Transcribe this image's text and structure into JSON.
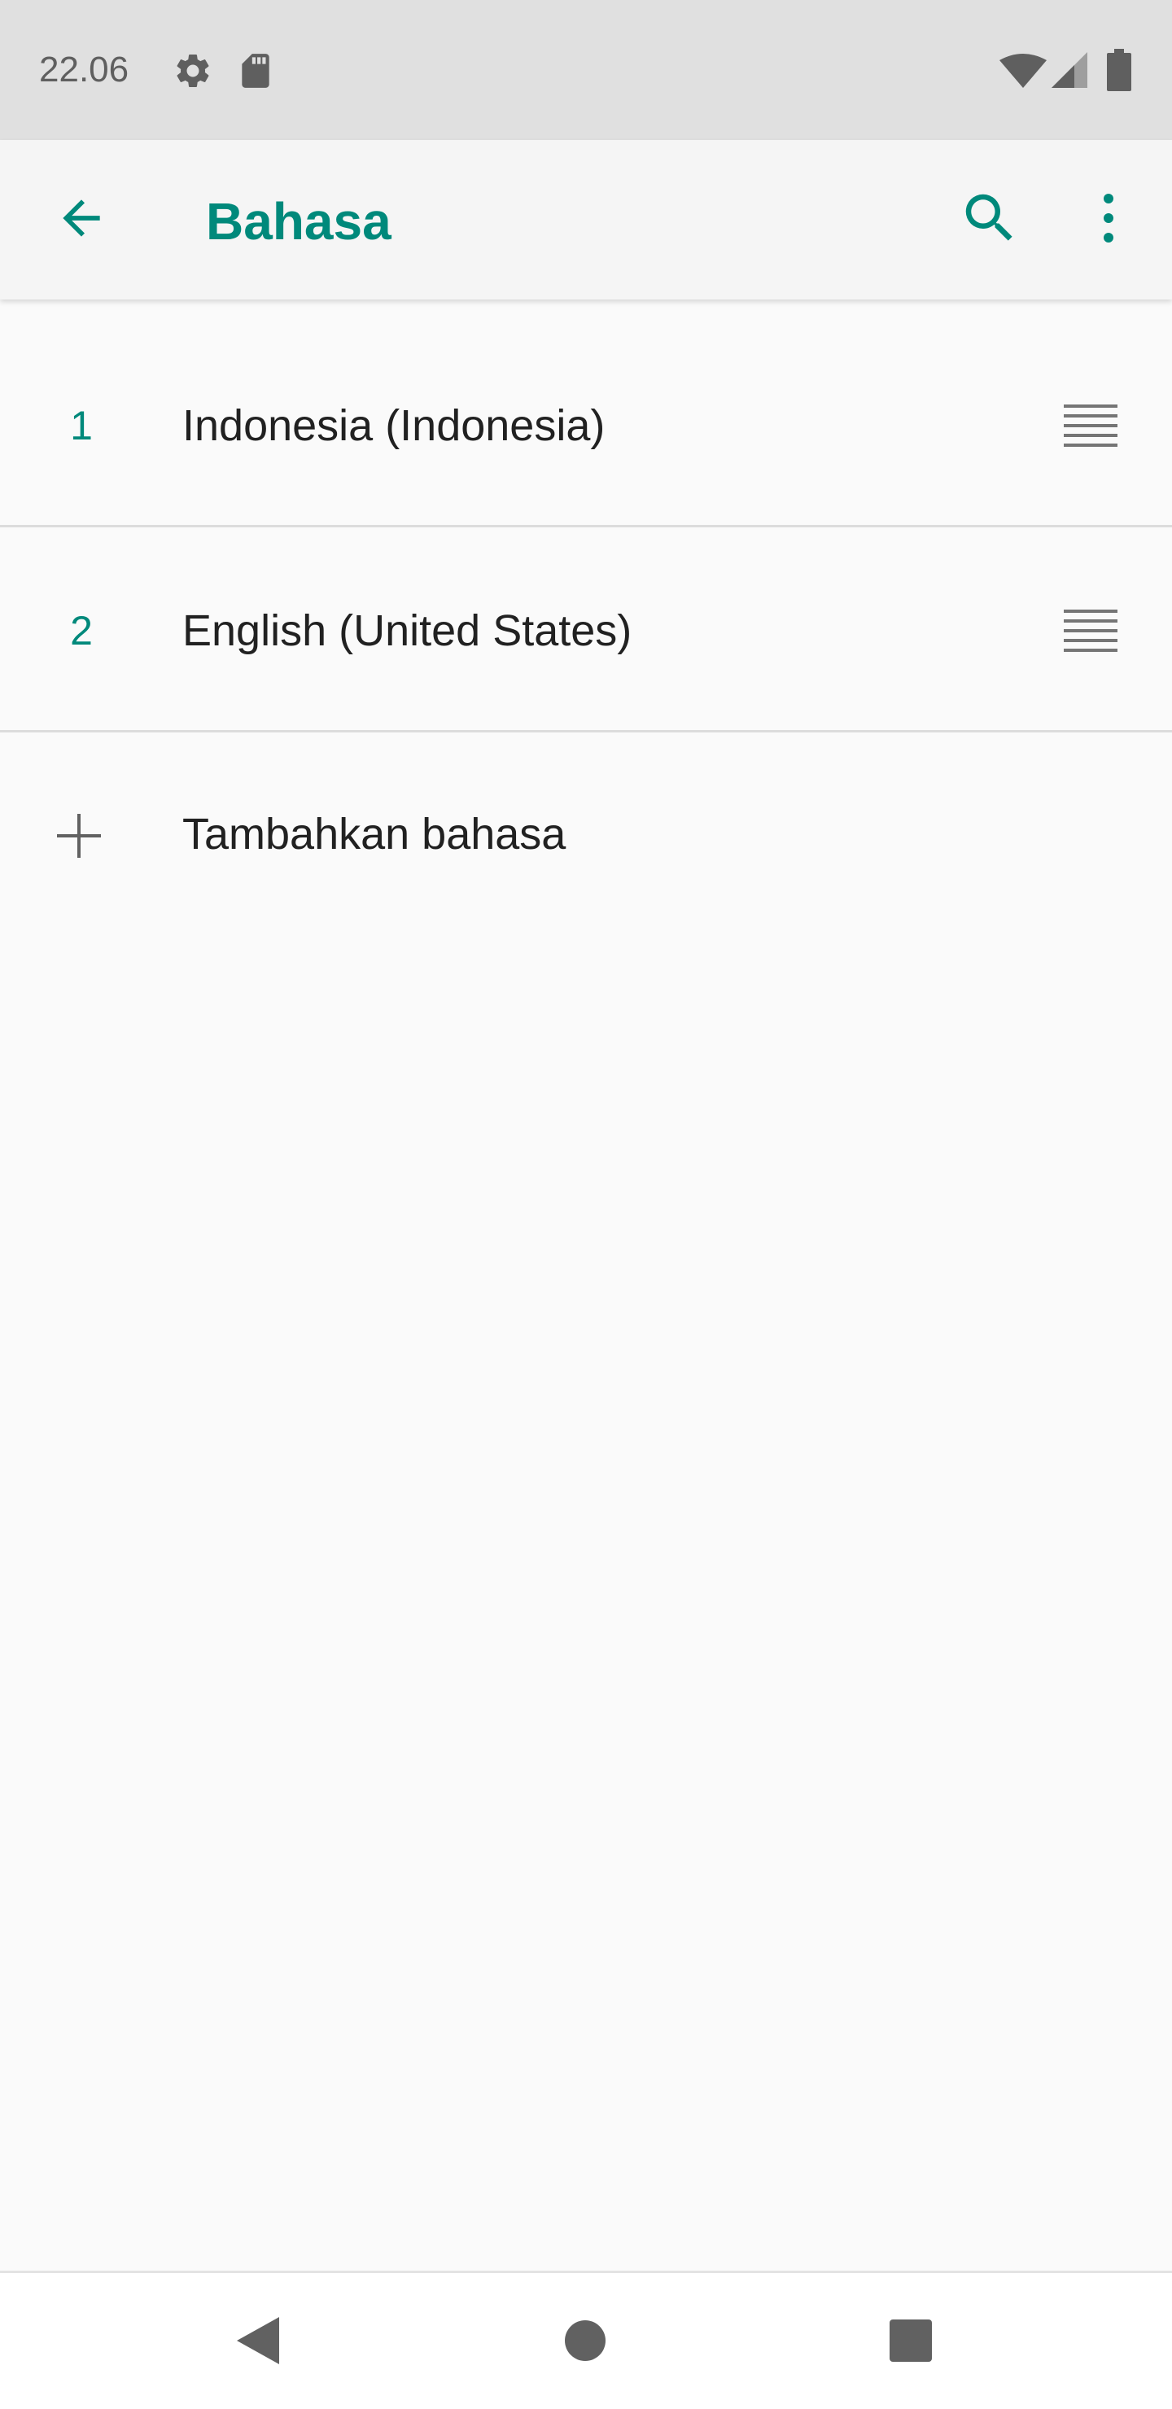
{
  "status_bar": {
    "time": "22.06",
    "icons": [
      "settings-icon",
      "sd-card-icon",
      "wifi-icon",
      "cell-signal-icon",
      "battery-icon"
    ]
  },
  "app_bar": {
    "title": "Bahasa",
    "back_icon": "arrow-back-icon",
    "search_icon": "search-icon",
    "more_icon": "more-vert-icon"
  },
  "languages": [
    {
      "order": "1",
      "label": "Indonesia (Indonesia)",
      "handle_icon": "drag-handle-icon"
    },
    {
      "order": "2",
      "label": "English (United States)",
      "handle_icon": "drag-handle-icon"
    }
  ],
  "add_language": {
    "icon": "plus-icon",
    "label": "Tambahkan bahasa"
  },
  "nav_bar": {
    "icons": [
      "back-triangle-icon",
      "home-circle-icon",
      "recents-square-icon"
    ]
  },
  "colors": {
    "accent": "#00897b",
    "status_bar_bg": "#e0e0e0",
    "app_bar_bg": "#f5f5f5",
    "background": "#fafafa",
    "text_primary": "#212121"
  }
}
